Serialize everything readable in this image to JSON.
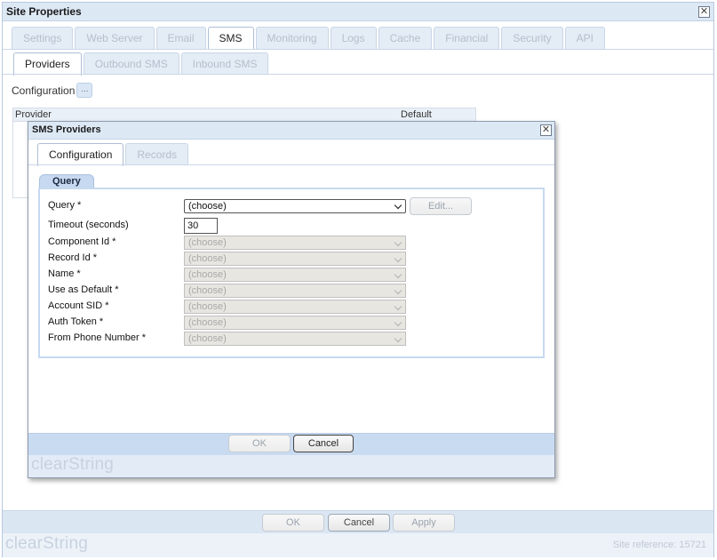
{
  "window": {
    "title": "Site Properties",
    "tabs": [
      "Settings",
      "Web Server",
      "Email",
      "SMS",
      "Monitoring",
      "Logs",
      "Cache",
      "Financial",
      "Security",
      "API"
    ],
    "active_tab": "SMS",
    "subtabs": [
      "Providers",
      "Outbound SMS",
      "Inbound SMS"
    ],
    "active_subtab": "Providers",
    "configuration_label": "Configuration",
    "configuration_button": "...",
    "grid_columns": [
      "Provider",
      "Default"
    ],
    "footer_buttons": {
      "ok": "OK",
      "cancel": "Cancel",
      "apply": "Apply"
    },
    "brand": "clearString",
    "site_reference": "Site reference: 15721"
  },
  "dialog": {
    "title": "SMS Providers",
    "tabs": [
      "Configuration",
      "Records"
    ],
    "active_tab": "Configuration",
    "group_title": "Query",
    "fields": [
      {
        "label": "Query *",
        "value": "(choose)"
      },
      {
        "label": "Timeout (seconds)",
        "value": "30"
      },
      {
        "label": "Component Id *",
        "value": "(choose)"
      },
      {
        "label": "Record Id *",
        "value": "(choose)"
      },
      {
        "label": "Name *",
        "value": "(choose)"
      },
      {
        "label": "Use as Default *",
        "value": "(choose)"
      },
      {
        "label": "Account SID *",
        "value": "(choose)"
      },
      {
        "label": "Auth Token *",
        "value": "(choose)"
      },
      {
        "label": "From Phone Number *",
        "value": "(choose)"
      }
    ],
    "edit_button": "Edit...",
    "ok_button": "OK",
    "cancel_button": "Cancel",
    "brand": "clearString"
  }
}
